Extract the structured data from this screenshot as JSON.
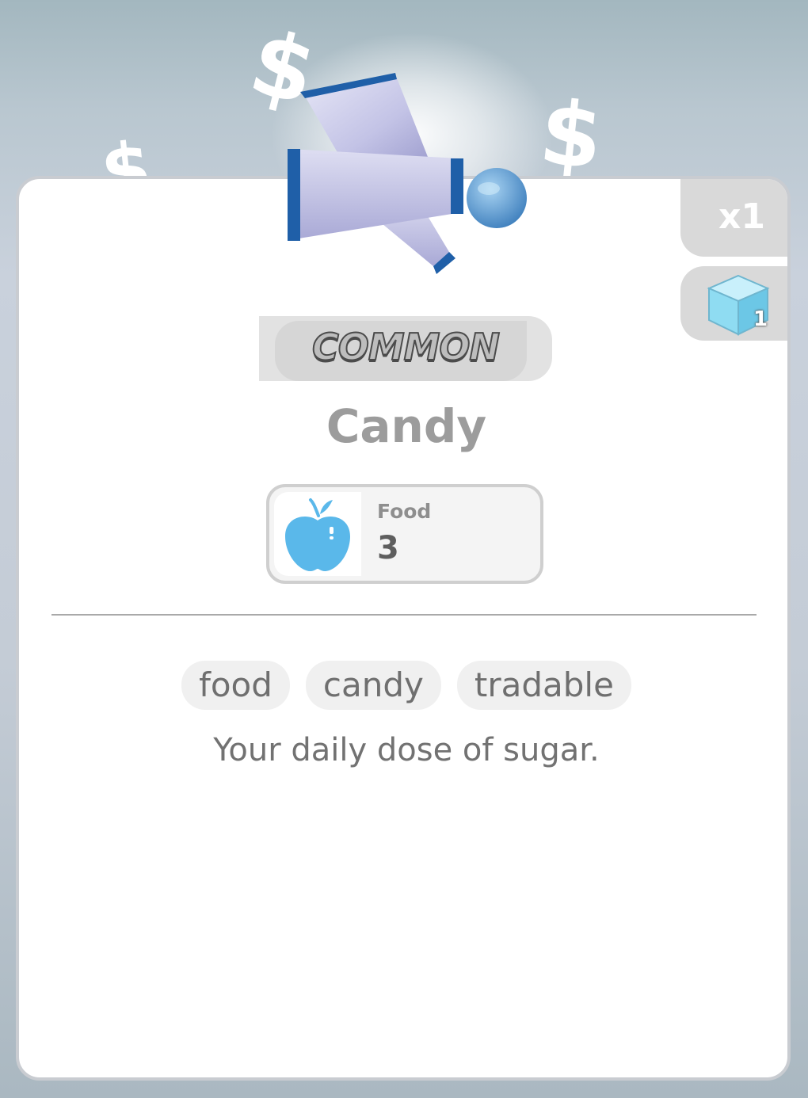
{
  "background": {
    "decorations": [
      "$",
      "$",
      "$"
    ],
    "icon": "dollar-sign-icon"
  },
  "item": {
    "graphic": "candy-wrapper-icon",
    "quantity": "x1",
    "cube_count": "1",
    "cube_icon": "ice-cube-icon",
    "rarity": "COMMON",
    "name": "Candy",
    "stat": {
      "icon": "apple-icon",
      "label": "Food",
      "value": "3"
    },
    "tags": [
      "food",
      "candy",
      "tradable"
    ],
    "description": "Your daily dose of sugar."
  },
  "colors": {
    "card_bg": "#ffffff",
    "card_border": "#c9ccd1",
    "tab_bg": "#d9d9d9",
    "apple": "#5ab8ea",
    "cube": "#8fdcf2",
    "candy": "#c8c8ea",
    "candy_trim": "#1f5fa8",
    "name_text": "#9c9c9c",
    "tag_bg": "#f0f0f0"
  }
}
